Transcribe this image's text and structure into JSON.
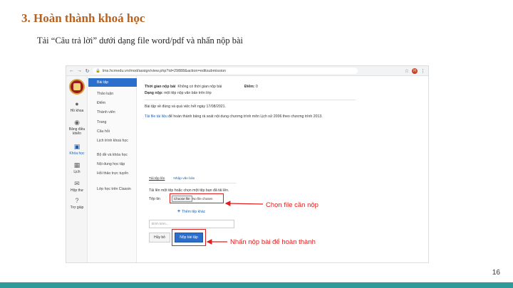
{
  "slide": {
    "title": "3. Hoàn thành khoá học",
    "subtitle": "Tải “Câu trả lời” dưới dạng file word/pdf và nhấn nộp bài",
    "page_number": "16"
  },
  "browser": {
    "back_glyph": "←",
    "forward_glyph": "→",
    "reload_glyph": "↻",
    "lock_glyph": "🔒",
    "url": "lms.hcmedu.vn/mod/assign/view.php?id=29888&action=editsubmission",
    "star_glyph": "☆",
    "avatar_letter": "H",
    "menu_glyph": "⋮"
  },
  "rail": {
    "items": [
      {
        "label": "Hồ khoa",
        "icon": "person-icon",
        "glyph": "●"
      },
      {
        "label": "Bảng điều khiển",
        "icon": "dashboard-icon",
        "glyph": "◉"
      },
      {
        "label": "Khóa học",
        "icon": "course-icon",
        "glyph": "▣"
      },
      {
        "label": "Lịch",
        "icon": "calendar-icon",
        "glyph": "▦"
      },
      {
        "label": "Hộp thư",
        "icon": "mail-icon",
        "glyph": "✉"
      },
      {
        "label": "Trợ giúp",
        "icon": "help-icon",
        "glyph": "?"
      }
    ]
  },
  "menu": {
    "items": [
      "Bài tập",
      "Thảo luận",
      "Điểm",
      "Thành viên",
      "Trang",
      "Câu hỏi",
      "Lịch trình khoá học",
      "Bộ đề và khóa học",
      "Nội dung học tập",
      "Hỏi thảo trực tuyến",
      "Lớp học trên Classin"
    ]
  },
  "content": {
    "time_label": "Thời gian nộp bài",
    "time_value": "Không có thời gian nộp bài",
    "score_label": "Điểm:",
    "score_value": "0",
    "type_label": "Dạng nộp:",
    "type_value": "một tệp nộp văn bản trên lớp",
    "deadline_text": "Bài tập về đúng và quá việc hết ngày 17/08/2021.",
    "instruction_link": "Tải file tài liệu",
    "instruction_rest": "để hoàn thành bảng rà soát nội dung chương trình môn Lịch sử 2006 theo chương trình 2013.",
    "tab_active": "Tải tệp lên",
    "tab_other": "Nhập văn bản",
    "upload_hint": "Tải lên một tệp hoặc chọn một tệp bạn đã tải lên.",
    "file_label": "Tệp tin",
    "choose_file": "Choose file",
    "no_file": "No file chosen",
    "add_folder": "Thêm tệp khác",
    "comment_placeholder": "Đính kèm...",
    "cancel_label": "Hủy bỏ",
    "submit_label": "Nộp bài tập"
  },
  "annotations": {
    "choose_file_callout": "Chọn file cần nộp",
    "submit_callout": "Nhấn nộp bài để hoàn thành",
    "color": "#e02020"
  },
  "colors": {
    "title": "#b5611f",
    "accent": "#2c6ecb",
    "bottom_bar": "#2f9a9a"
  }
}
